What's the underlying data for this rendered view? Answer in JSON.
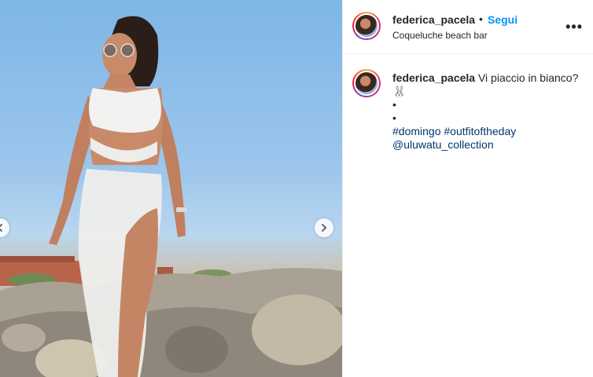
{
  "post": {
    "username": "federica_pacela",
    "separator": "•",
    "follow_label": "Segui",
    "location": "Coqueluche beach bar",
    "more_label": "•••"
  },
  "caption": {
    "username": "federica_pacela",
    "text": "Vi piaccio in bianco?",
    "emoji": "🐰",
    "dot1": "•",
    "dot2": "•",
    "hashtag1": "#domingo",
    "hashtag2": "#outfitoftheday",
    "mention": "@uluwatu_collection"
  },
  "icons": {
    "next": "chevron-right-icon",
    "prev": "chevron-left-icon",
    "more": "ellipsis-icon"
  }
}
